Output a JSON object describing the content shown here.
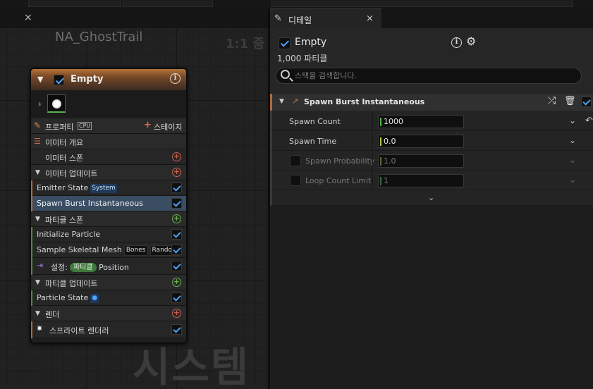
{
  "graph": {
    "close_glyph": "×",
    "title": "NA_GhostTrail",
    "zoom": "1:1 줌",
    "watermark": "시스템"
  },
  "node": {
    "title": "Empty",
    "enabled": true,
    "info_glyph": "i",
    "properties_label": "프로퍼티",
    "cpu_label": "CPU",
    "stage_label": "스테이지",
    "rows": {
      "emitter_summary": "이미터 개요",
      "emitter_spawn": "이미터 스폰",
      "emitter_update": "이미터 업데이트",
      "emitter_state": "Emitter State",
      "emitter_state_tag": "System",
      "spawn_burst": "Spawn Burst Instantaneous",
      "particle_spawn": "파티클 스폰",
      "initialize_particle": "Initialize Particle",
      "sample_skeletal_mesh": "Sample Skeletal Mesh",
      "sample_tag_1": "Bones",
      "sample_tag_2": "Random",
      "set_label": "설정:",
      "set_tag": "파티클",
      "set_value": "Position",
      "particle_update": "파티클 업데이트",
      "particle_state": "Particle State",
      "render": "렌더",
      "sprite_renderer": "스프라이트 렌더러"
    }
  },
  "details": {
    "tab_label": "디테일",
    "close_glyph": "×",
    "emitter_name": "Empty",
    "particle_count": "1,000 파티클",
    "search_placeholder": "스택을 검색합니다.",
    "category_title": "Spawn Burst Instantaneous",
    "properties": [
      {
        "label": "Spawn Count",
        "value": "1000",
        "enabled": true
      },
      {
        "label": "Spawn Time",
        "value": "0.0",
        "enabled": true
      },
      {
        "label": "Spawn Probability",
        "value": "1.0",
        "enabled": false
      },
      {
        "label": "Loop Count Limit",
        "value": "1",
        "enabled": false
      }
    ]
  },
  "colors": {
    "accent_blue": "#4ba3ff",
    "node_header_orange": "#b4743a",
    "add_red": "#c95f4d",
    "add_green": "#6bad4f",
    "highlight_row": "#3b4d63"
  }
}
